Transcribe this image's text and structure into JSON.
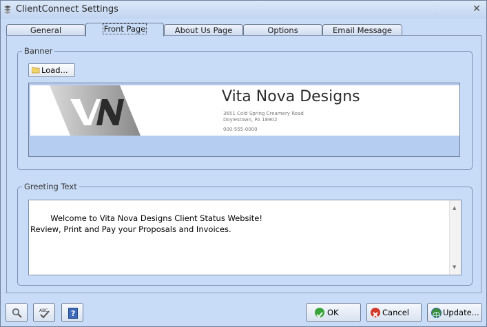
{
  "window": {
    "title": "ClientConnect Settings",
    "close_glyph": "✕"
  },
  "tabs": [
    {
      "label": "General",
      "active": false
    },
    {
      "label": "Front Page",
      "active": true
    },
    {
      "label": "About Us Page",
      "active": false
    },
    {
      "label": "Options",
      "active": false
    },
    {
      "label": "Email Message",
      "active": false
    }
  ],
  "banner": {
    "legend": "Banner",
    "load_label": "Load...",
    "logo": {
      "company": "Vita Nova Designs",
      "address1": "3651 Cold Spring Creamery Road",
      "address2": "Doylestown, PA 18902",
      "phone": "000-555-0000"
    }
  },
  "greeting": {
    "legend": "Greeting Text",
    "text": "Welcome to Vita Nova Designs Client Status Website!\nReview, Print and Pay your Proposals and Invoices."
  },
  "buttons": {
    "ok": "OK",
    "cancel": "Cancel",
    "update": "Update..."
  },
  "icons": {
    "search": "magnifier-icon",
    "spellcheck": "spellcheck-icon",
    "help": "help-icon"
  },
  "colors": {
    "window_bg": "#c9dcf7",
    "ok_green": "#3aa53a",
    "cancel_red": "#d23a2c"
  }
}
